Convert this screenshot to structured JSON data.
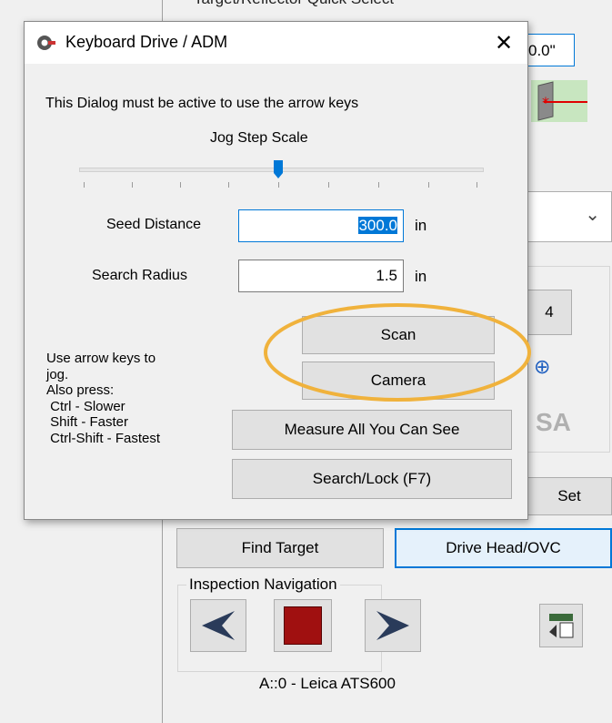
{
  "background": {
    "header_partial": "Target/Reflector Quick Select",
    "value_box": "0.0\"",
    "set_button": "Set",
    "number_button": "4",
    "find_target_button": "Find Target",
    "drive_head_button": "Drive Head/OVC",
    "inspection_nav_label": "Inspection Navigation",
    "status_text": "A::0 - Leica ATS600"
  },
  "dialog": {
    "title": "Keyboard Drive / ADM",
    "instruction": "This Dialog must be active to use the arrow keys",
    "jog_label": "Jog Step Scale",
    "jog_scale_position": 0.5,
    "seed_distance": {
      "label": "Seed Distance",
      "value": "300.0",
      "unit": "in"
    },
    "search_radius": {
      "label": "Search Radius",
      "value": "1.5",
      "unit": "in"
    },
    "help_lines": [
      "Use arrow keys to",
      "jog.",
      "Also press:",
      " Ctrl - Slower",
      " Shift - Faster",
      " Ctrl-Shift - Fastest"
    ],
    "buttons": {
      "scan": "Scan",
      "camera": "Camera",
      "measure_all": "Measure All You Can See",
      "search_lock": "Search/Lock (F7)"
    }
  },
  "colors": {
    "highlight_ellipse": "#f0b23c",
    "accent": "#0078d7",
    "stop": "#a01010"
  }
}
